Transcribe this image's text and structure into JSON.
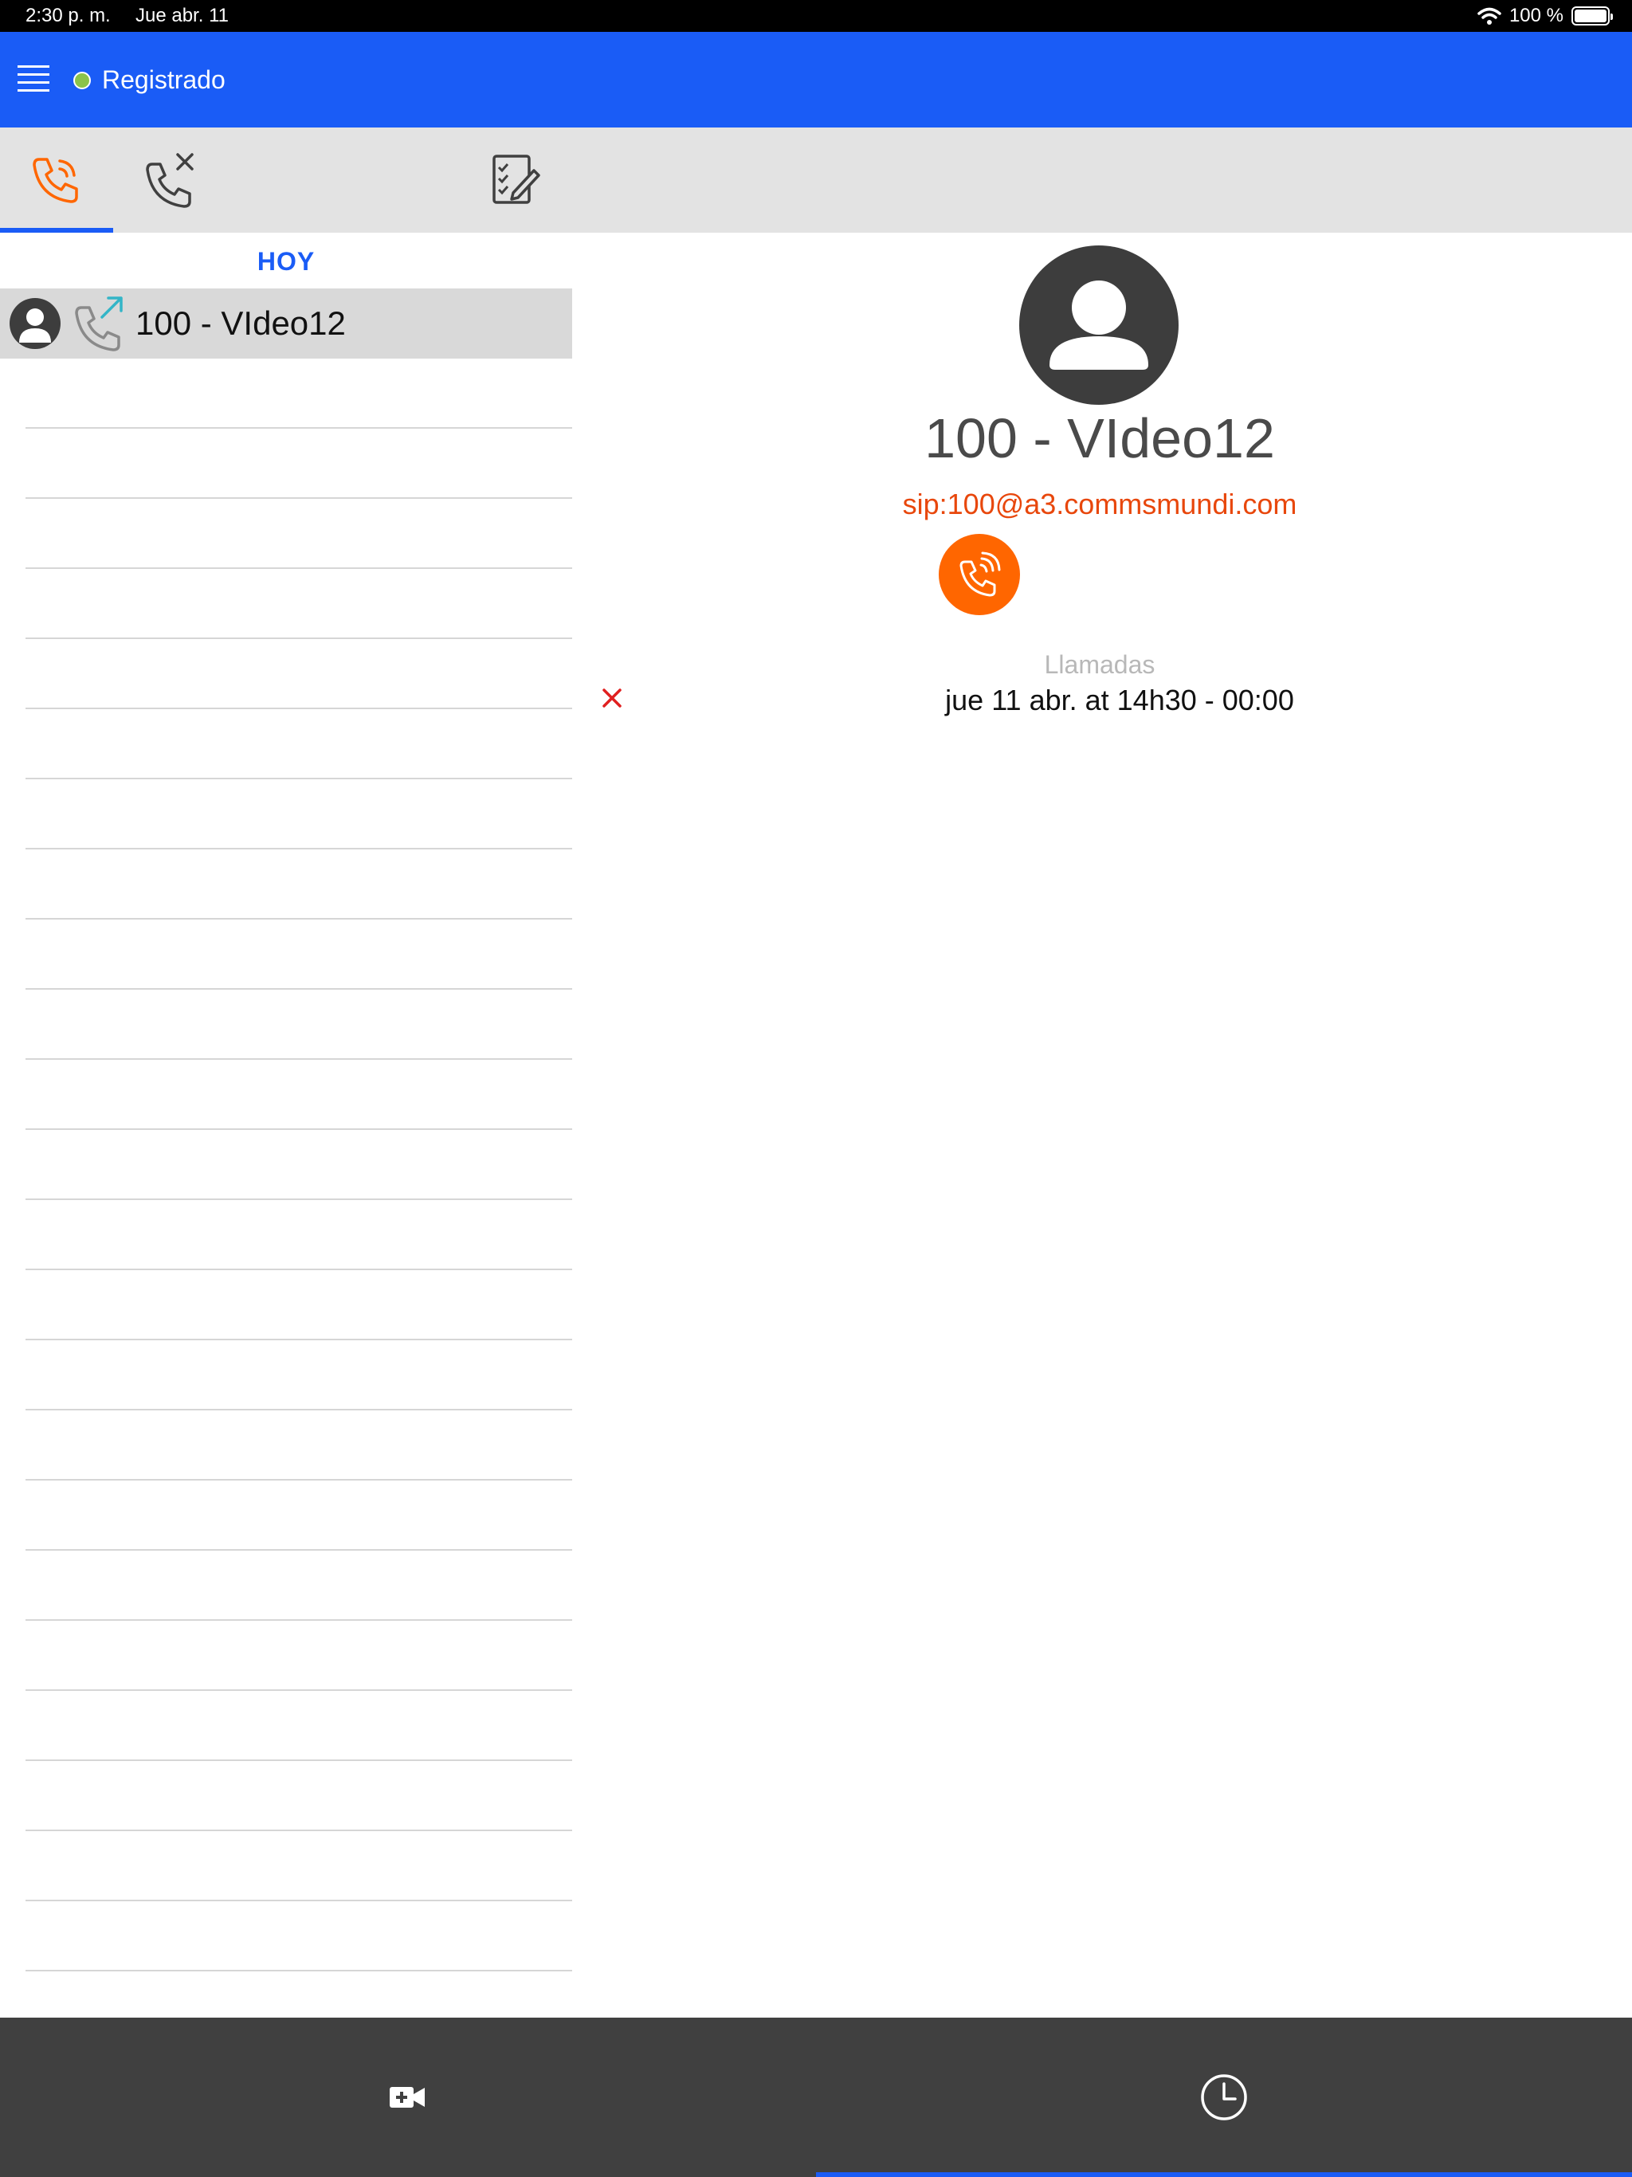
{
  "status_bar": {
    "time": "2:30 p. m.",
    "date": "Jue abr. 11",
    "battery": "100 %",
    "battery_level": 1.0
  },
  "header": {
    "status": "Registrado",
    "status_color": "#8bc34a",
    "background": "#1a5cf6"
  },
  "tabs": [
    {
      "icon": "phone-history-icon",
      "active": true
    },
    {
      "icon": "missed-call-icon",
      "active": false
    },
    {
      "icon": "checklist-edit-icon",
      "active": false
    }
  ],
  "call_list": {
    "section": "HOY",
    "rows": [
      {
        "label": "100 - VIdeo12",
        "icon": "outgoing-call-icon"
      }
    ]
  },
  "detail": {
    "name": "100 - VIdeo12",
    "sip": "sip:100@a3.commsmundi.com",
    "calls_title": "Llamadas",
    "calls": [
      {
        "text": "jue 11 abr. at 14h30 - 00:00"
      }
    ]
  },
  "bottom_nav": [
    {
      "icon": "video-call-icon",
      "active": false
    },
    {
      "icon": "clock-icon",
      "active": true
    }
  ],
  "colors": {
    "accent": "#1a5cf6",
    "orange": "#ff6600",
    "sip": "#e8470c",
    "delete": "#e02020"
  }
}
